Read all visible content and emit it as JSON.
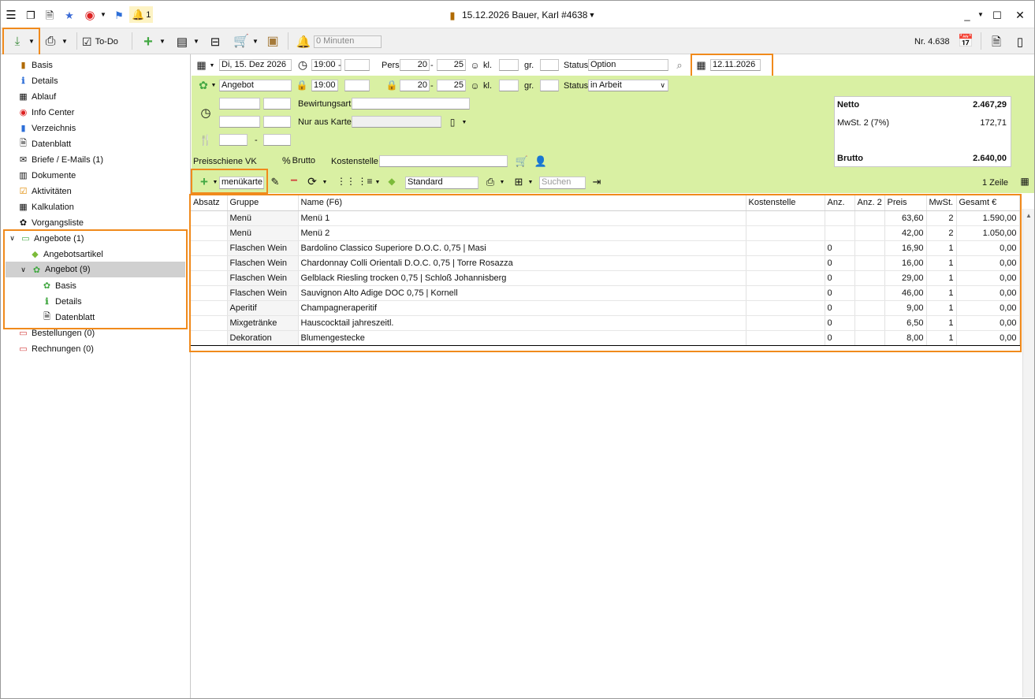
{
  "window": {
    "title": "15.12.2026 Bauer, Karl #4638",
    "notification_count": "1"
  },
  "toolbar": {
    "todo_label": "To-Do",
    "timer_value": "0 Minuten",
    "record_number": "Nr. 4.638"
  },
  "sidebar": {
    "items": [
      {
        "label": "Basis"
      },
      {
        "label": "Details"
      },
      {
        "label": "Ablauf"
      },
      {
        "label": "Info Center"
      },
      {
        "label": "Verzeichnis"
      },
      {
        "label": "Datenblatt"
      },
      {
        "label": "Briefe / E-Mails (1)"
      },
      {
        "label": "Dokumente"
      },
      {
        "label": "Aktivitäten"
      },
      {
        "label": "Kalkulation"
      },
      {
        "label": "Vorgangsliste"
      },
      {
        "label": "Angebote (1)"
      },
      {
        "label": "Angebotsartikel"
      },
      {
        "label": "Angebot (9)"
      },
      {
        "label": "Basis"
      },
      {
        "label": "Details"
      },
      {
        "label": "Datenblatt"
      },
      {
        "label": "Bestellungen (0)"
      },
      {
        "label": "Rechnungen (0)"
      }
    ]
  },
  "event": {
    "date": "Di, 15. Dez 2026",
    "time_from": "19:00",
    "time_to": "",
    "pers_label": "Pers.",
    "pers_from": "20",
    "pers_to": "25",
    "kl_label": "kl.",
    "kl_value": "",
    "gr_label": "gr.",
    "gr_value": "",
    "status_label": "Status",
    "status_value": "Option",
    "due_date": "12.11.2026"
  },
  "offer": {
    "name": "Angebot",
    "time_from": "19:00",
    "time_to": "",
    "pers_from": "20",
    "pers_to": "25",
    "kl_label": "kl.",
    "gr_label": "gr.",
    "status_label": "Status",
    "status_value": "in Arbeit",
    "bewirtungsart_label": "Bewirtungsart",
    "bewirtungsart_value": "",
    "nur_aus_karte_label": "Nur aus Karte",
    "nur_aus_karte_value": "",
    "range_sep": "-",
    "preisschiene_label": "Preisschiene VK",
    "brutto_toggle": "Brutto",
    "kostenstelle_label": "Kostenstelle",
    "kostenstelle_value": ""
  },
  "totals": {
    "netto_label": "Netto",
    "netto_value": "2.467,29",
    "mwst_label": "MwSt. 2 (7%)",
    "mwst_value": "172,71",
    "brutto_label": "Brutto",
    "brutto_value": "2.640,00"
  },
  "list_toolbar": {
    "menu_input": "menükarte",
    "view_select": "Standard",
    "search_placeholder": "Suchen",
    "row_count": "1 Zeile"
  },
  "table": {
    "columns": [
      "Absatz",
      "Gruppe",
      "Name (F6)",
      "Kostenstelle",
      "Anz.",
      "Anz. 2",
      "Preis",
      "MwSt.",
      "Gesamt €"
    ],
    "rows": [
      {
        "absatz": "",
        "gruppe": "Menü",
        "name": "Menü 1",
        "kostenstelle": "",
        "anz": "",
        "anz2": "",
        "preis": "63,60",
        "mwst": "2",
        "gesamt": "1.590,00"
      },
      {
        "absatz": "",
        "gruppe": "Menü",
        "name": "Menü 2",
        "kostenstelle": "",
        "anz": "",
        "anz2": "",
        "preis": "42,00",
        "mwst": "2",
        "gesamt": "1.050,00"
      },
      {
        "absatz": "",
        "gruppe": "Flaschen Wein",
        "name": "Bardolino Classico Superiore D.O.C. 0,75 | Masi",
        "kostenstelle": "",
        "anz": "0",
        "anz2": "",
        "preis": "16,90",
        "mwst": "1",
        "gesamt": "0,00"
      },
      {
        "absatz": "",
        "gruppe": "Flaschen Wein",
        "name": "Chardonnay Colli Orientali D.O.C. 0,75 | Torre Rosazza",
        "kostenstelle": "",
        "anz": "0",
        "anz2": "",
        "preis": "16,00",
        "mwst": "1",
        "gesamt": "0,00"
      },
      {
        "absatz": "",
        "gruppe": "Flaschen Wein",
        "name": "Gelblack Riesling trocken 0,75 | Schloß Johannisberg",
        "kostenstelle": "",
        "anz": "0",
        "anz2": "",
        "preis": "29,00",
        "mwst": "1",
        "gesamt": "0,00"
      },
      {
        "absatz": "",
        "gruppe": "Flaschen Wein",
        "name": "Sauvignon Alto Adige DOC 0,75 | Kornell",
        "kostenstelle": "",
        "anz": "0",
        "anz2": "",
        "preis": "46,00",
        "mwst": "1",
        "gesamt": "0,00"
      },
      {
        "absatz": "",
        "gruppe": "Aperitif",
        "name": "Champagneraperitif",
        "kostenstelle": "",
        "anz": "0",
        "anz2": "",
        "preis": "9,00",
        "mwst": "1",
        "gesamt": "0,00"
      },
      {
        "absatz": "",
        "gruppe": "Mixgetränke",
        "name": "Hauscocktail jahreszeitl.",
        "kostenstelle": "",
        "anz": "0",
        "anz2": "",
        "preis": "6,50",
        "mwst": "1",
        "gesamt": "0,00"
      },
      {
        "absatz": "",
        "gruppe": "Dekoration",
        "name": "Blumengestecke",
        "kostenstelle": "",
        "anz": "0",
        "anz2": "",
        "preis": "8,00",
        "mwst": "1",
        "gesamt": "0,00"
      }
    ]
  },
  "colors": {
    "accent_orange": "#f08a1c",
    "panel_green": "#d9f0a3",
    "selection_gray": "#d0d0d0"
  }
}
